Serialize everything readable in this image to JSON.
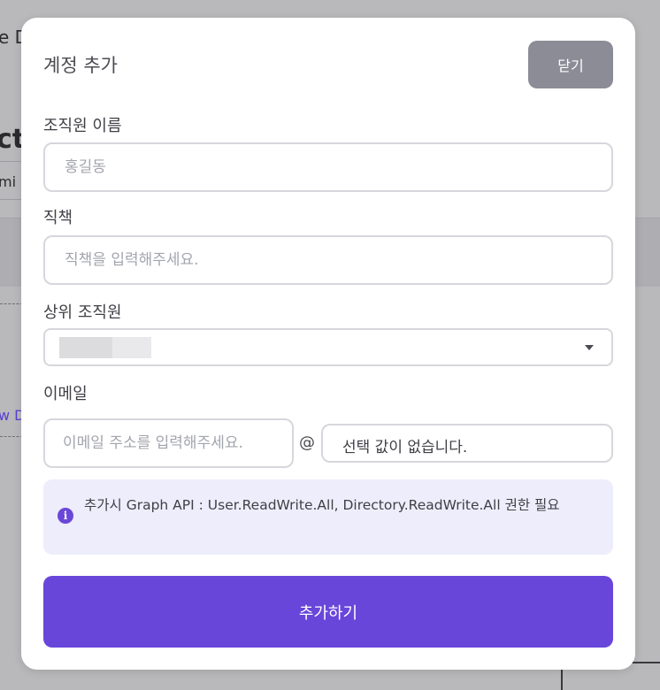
{
  "background": {
    "fragment_1": "e D",
    "fragment_2": "ct",
    "fragment_3": "mi",
    "fragment_4": "w D"
  },
  "modal": {
    "title": "계정 추가",
    "close_label": "닫기",
    "name_field": {
      "label": "조직원 이름",
      "placeholder": "홍길동",
      "value": ""
    },
    "position_field": {
      "label": "직책",
      "placeholder": "직책을 입력해주세요.",
      "value": ""
    },
    "parent_field": {
      "label": "상위 조직원"
    },
    "email_field": {
      "label": "이메일",
      "placeholder": "이메일 주소를 입력해주세요.",
      "at": "@",
      "domain_value": "선택 값이 없습니다."
    },
    "notice": {
      "icon": "info-icon",
      "text": "추가시 Graph API : User.ReadWrite.All, Directory.ReadWrite.All 권한 필요"
    },
    "submit_label": "추가하기"
  },
  "colors": {
    "accent": "#6846da",
    "close_button": "#8b8c96",
    "notice_background": "#eeedfb"
  }
}
